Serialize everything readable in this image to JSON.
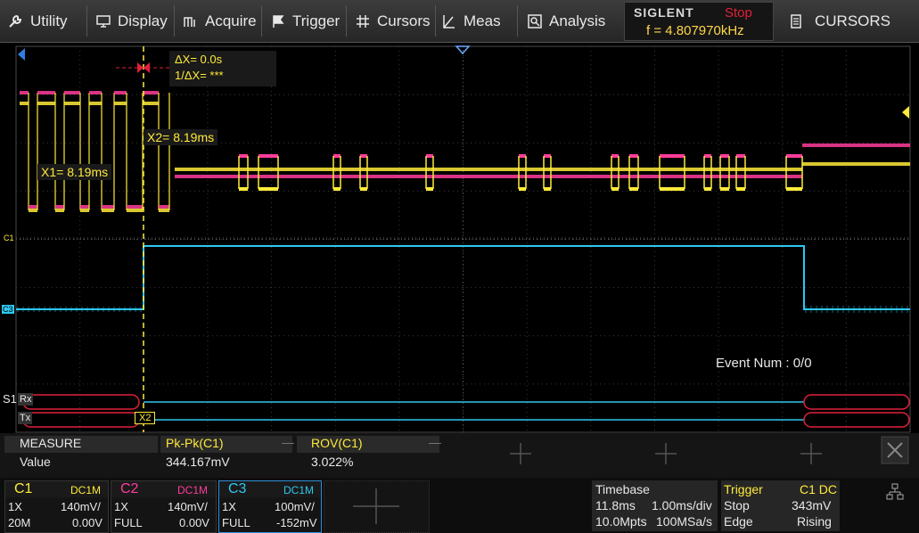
{
  "menu": {
    "utility": "Utility",
    "display": "Display",
    "acquire": "Acquire",
    "trigger": "Trigger",
    "cursors": "Cursors",
    "meas": "Meas",
    "analysis": "Analysis"
  },
  "status": {
    "brand": "SIGLENT",
    "run_state": "Stop",
    "frequency": "f = 4.807970kHz",
    "mode_label": "CURSORS"
  },
  "cursor_readout": {
    "delta_x": "ΔX= 0.0s",
    "inv_delta_x": "1/ΔX= ***",
    "x1": "X1= 8.19ms",
    "x2": "X2= 8.19ms",
    "x2_marker": "X2"
  },
  "channel_tags": {
    "c1": "C1",
    "c3": "C3",
    "s1": "S1",
    "rx": "Rx",
    "tx": "Tx"
  },
  "event_num": "Event Num : 0/0",
  "measure": {
    "title": "MEASURE",
    "row_label": "Value",
    "items": [
      {
        "name": "Pk-Pk(C1)",
        "value": "344.167mV"
      },
      {
        "name": "ROV(C1)",
        "value": "3.022%"
      }
    ]
  },
  "channels": [
    {
      "name": "C1",
      "coupling": "DC1M",
      "probe": "1X",
      "scale": "140mV/",
      "bw": "20M",
      "offset": "0.00V",
      "color": "#ffea3a"
    },
    {
      "name": "C2",
      "coupling": "DC1M",
      "probe": "1X",
      "scale": "140mV/",
      "bw": "FULL",
      "offset": "0.00V",
      "color": "#ff3c9a"
    },
    {
      "name": "C3",
      "coupling": "DC1M",
      "probe": "1X",
      "scale": "100mV/",
      "bw": "FULL",
      "offset": "-152mV",
      "color": "#2ec8f0"
    }
  ],
  "timebase": {
    "label": "Timebase",
    "delay": "11.8ms",
    "scale": "1.00ms/div",
    "memory": "10.0Mpts",
    "sample_rate": "100MSa/s"
  },
  "trigger": {
    "label": "Trigger",
    "source": "C1 DC",
    "mode": "Stop",
    "level": "343mV",
    "type": "Edge",
    "slope": "Rising"
  },
  "colors": {
    "c1": "#ffea3a",
    "c2": "#ff3c9a",
    "c3": "#2ec8f0",
    "cursor": "#ffea3a",
    "stop": "#e0203a",
    "decode_frame": "#e0203a"
  }
}
